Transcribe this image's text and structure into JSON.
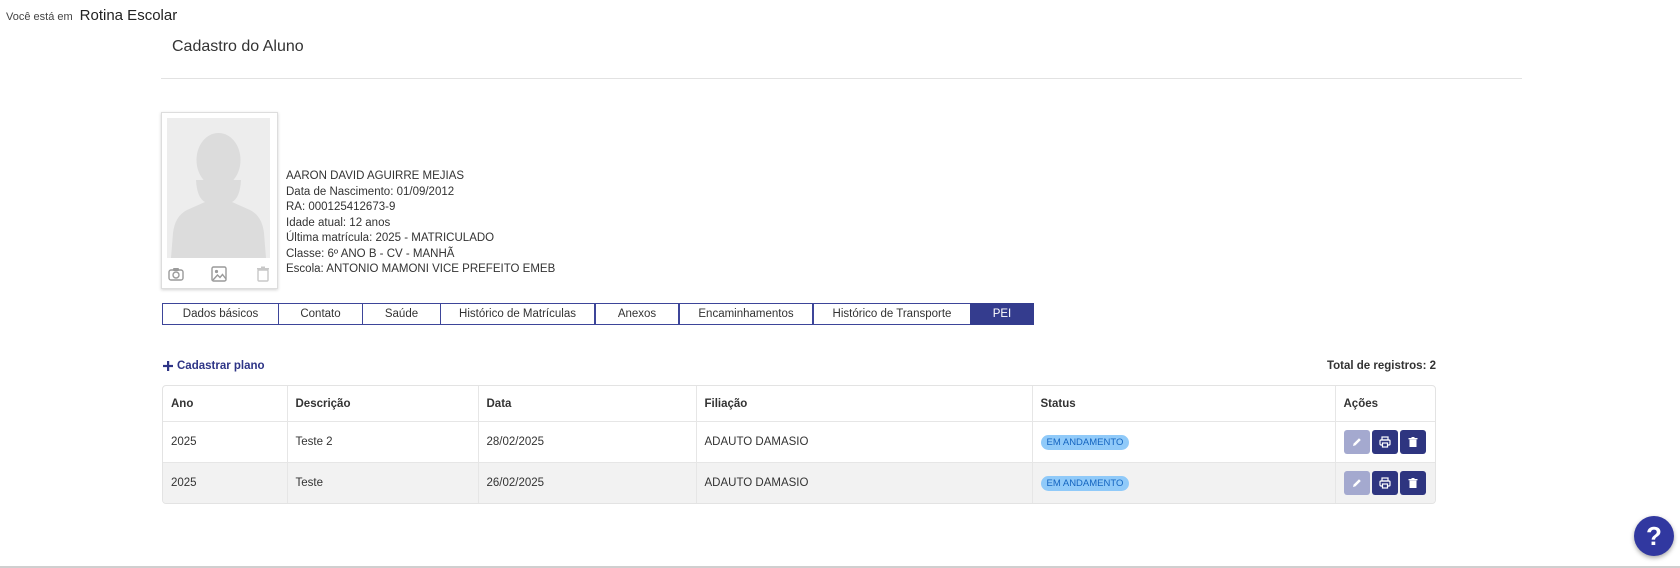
{
  "breadcrumb": {
    "prefix": "Você está em",
    "current": "Rotina Escolar"
  },
  "page_title": "Cadastro do Aluno",
  "photo_actions": [
    "camera-icon",
    "image-icon",
    "trash-icon"
  ],
  "student": {
    "name": "AARON DAVID AGUIRRE MEJIAS",
    "birth": "Data de Nascimento: 01/09/2012",
    "ra": "RA: 000125412673-9",
    "age": "Idade atual: 12 anos",
    "enrollment": "Última matrícula: 2025 - MATRICULADO",
    "class": "Classe: 6º ANO B - CV - MANHÃ",
    "school": "Escola: ANTONIO MAMONI VICE PREFEITO EMEB"
  },
  "tabs": [
    {
      "label": "Dados básicos",
      "active": false
    },
    {
      "label": "Contato",
      "active": false
    },
    {
      "label": "Saúde",
      "active": false
    },
    {
      "label": "Histórico de Matrículas",
      "active": false
    },
    {
      "label": "Anexos",
      "active": false
    },
    {
      "label": "Encaminhamentos",
      "active": false
    },
    {
      "label": "Histórico de Transporte",
      "active": false
    },
    {
      "label": "PEI",
      "active": true
    }
  ],
  "toolbar": {
    "add_plan": "Cadastrar plano",
    "total": "Total de registros: 2"
  },
  "table": {
    "headers": [
      "Ano",
      "Descrição",
      "Data",
      "Filiação",
      "Status",
      "Ações"
    ],
    "rows": [
      {
        "ano": "2025",
        "descricao": "Teste 2",
        "data": "28/02/2025",
        "filiacao": "ADAUTO DAMASIO",
        "status": "EM ANDAMENTO"
      },
      {
        "ano": "2025",
        "descricao": "Teste",
        "data": "26/02/2025",
        "filiacao": "ADAUTO DAMASIO",
        "status": "EM ANDAMENTO"
      }
    ]
  },
  "help": {
    "label": "?"
  },
  "colors": {
    "primary": "#343c8e",
    "badge_bg": "#90caf9",
    "badge_text": "#1565c0",
    "edit_disabled": "#a4a9cf"
  }
}
